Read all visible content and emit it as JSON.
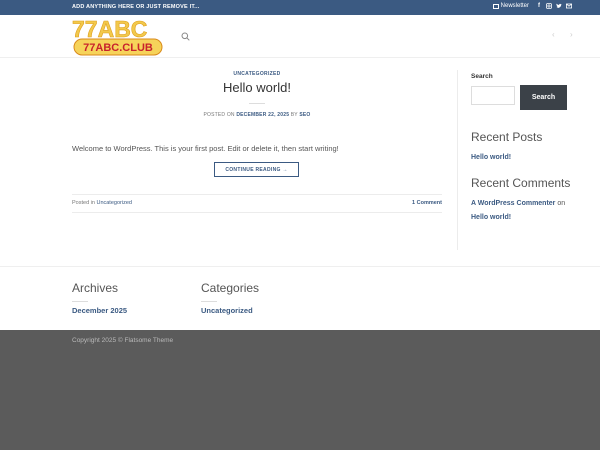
{
  "topbar": {
    "message": "ADD ANYTHING HERE OR JUST REMOVE IT...",
    "newsletter_label": "Newsletter",
    "social": [
      "facebook-icon",
      "instagram-icon",
      "twitter-icon",
      "email-icon"
    ]
  },
  "header": {
    "logo_top": "77ABC",
    "logo_bottom": "77ABC.CLUB"
  },
  "post": {
    "category": "UNCATEGORIZED",
    "title": "Hello world!",
    "meta_prefix": "POSTED ON ",
    "meta_date": "DECEMBER 22, 2025",
    "meta_by": " BY ",
    "meta_author": "SEO",
    "excerpt": "Welcome to WordPress. This is your first post. Edit or delete it, then start writing!",
    "read_more": "CONTINUE READING →",
    "posted_in_prefix": "Posted in ",
    "posted_in_cat": "Uncategorized",
    "comments_link": "1 Comment"
  },
  "sidebar": {
    "search_label": "Search",
    "search_button": "Search",
    "recent_posts_title": "Recent Posts",
    "recent_post": "Hello world!",
    "recent_comments_title": "Recent Comments",
    "commenter": "A WordPress Commenter",
    "comment_on": " on ",
    "comment_post": "Hello world!"
  },
  "footer": {
    "archives_title": "Archives",
    "archive_item": "December 2025",
    "categories_title": "Categories",
    "category_item": "Uncategorized",
    "copyright": "Copyright 2025 © Flatsome Theme"
  },
  "colors": {
    "topbar": "#3b5a82",
    "link": "#3b5a82",
    "button_dark": "#3b4148",
    "footer_dark": "#5b5b5b"
  }
}
